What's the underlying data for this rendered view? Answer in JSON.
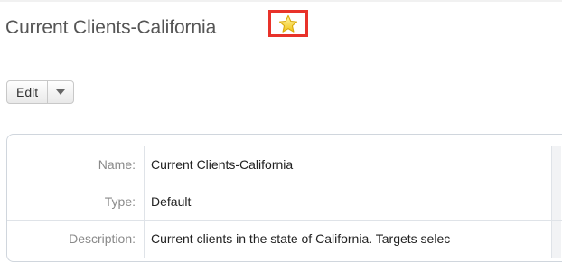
{
  "header": {
    "title": "Current Clients-California",
    "favorite_icon": "star-icon",
    "highlight_color": "#e8322a",
    "star_color": "#f5d533"
  },
  "actions": {
    "edit_label": "Edit",
    "dropdown_icon": "chevron-down-icon"
  },
  "record": {
    "fields": [
      {
        "label": "Name:",
        "value": "Current Clients-California"
      },
      {
        "label": "Type:",
        "value": "Default"
      },
      {
        "label": "Description:",
        "value": "Current clients in the state of California. Targets selec"
      }
    ]
  }
}
